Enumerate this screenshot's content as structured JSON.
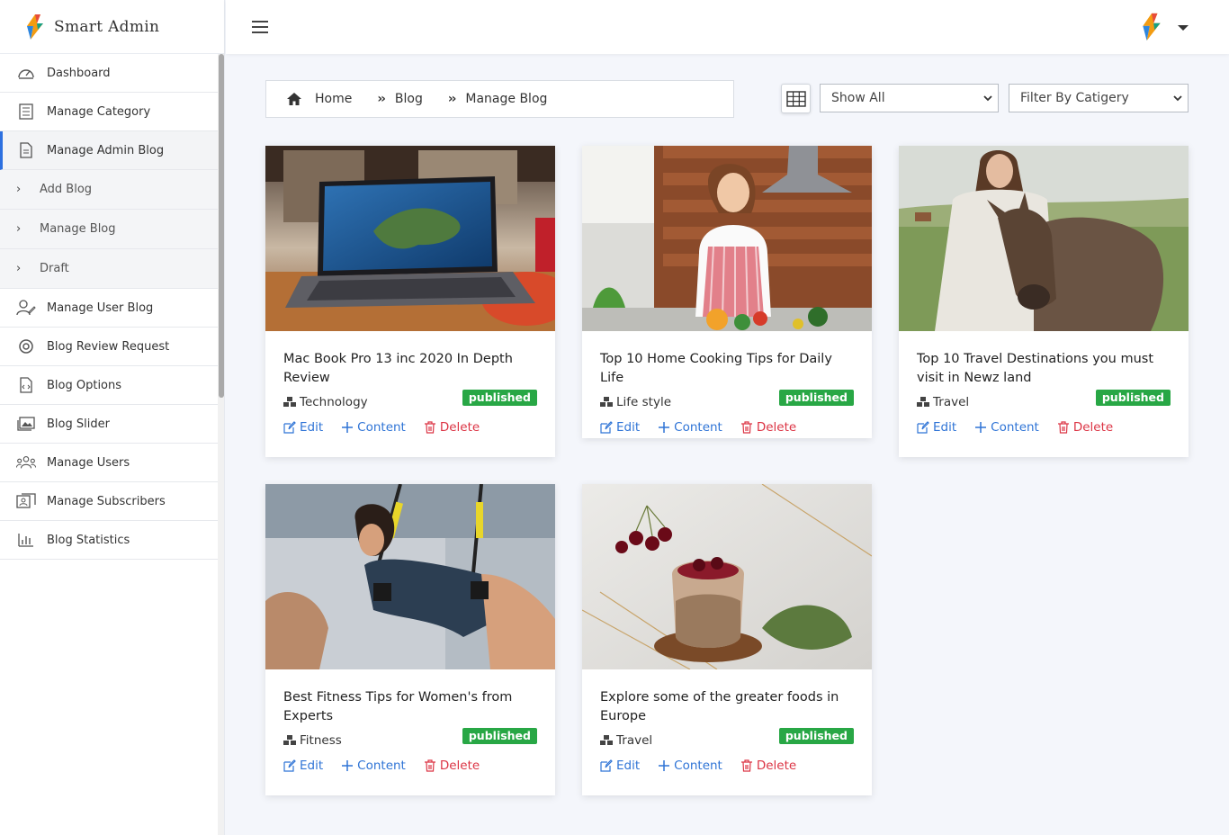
{
  "brand": {
    "name": "Smart Admin"
  },
  "sidebar": {
    "items": [
      {
        "label": "Dashboard",
        "icon": "dashboard-icon"
      },
      {
        "label": "Manage Category",
        "icon": "list-icon"
      },
      {
        "label": "Manage Admin Blog",
        "icon": "document-icon",
        "active": true
      },
      {
        "label": "Add Blog",
        "sub": true
      },
      {
        "label": "Manage Blog",
        "sub": true
      },
      {
        "label": "Draft",
        "sub": true
      },
      {
        "label": "Manage User Blog",
        "icon": "user-edit-icon"
      },
      {
        "label": "Blog Review Request",
        "icon": "review-icon"
      },
      {
        "label": "Blog Options",
        "icon": "file-code-icon"
      },
      {
        "label": "Blog Slider",
        "icon": "images-icon"
      },
      {
        "label": "Manage Users",
        "icon": "users-icon"
      },
      {
        "label": "Manage Subscribers",
        "icon": "subscribers-icon"
      },
      {
        "label": "Blog Statistics",
        "icon": "chart-icon"
      }
    ]
  },
  "breadcrumb": {
    "home": "Home",
    "blog": "Blog",
    "current": "Manage Blog"
  },
  "filters": {
    "show": "Show All",
    "category": "Filter By Catigery"
  },
  "actions": {
    "edit": "Edit",
    "content": "Content",
    "delete": "Delete"
  },
  "cards": [
    {
      "title": "Mac Book Pro 13 inc 2020 In Depth Review",
      "category": "Technology",
      "status": "published"
    },
    {
      "title": "Top 10 Home Cooking Tips for Daily Life",
      "category": "Life style",
      "status": "published"
    },
    {
      "title": "Top 10 Travel Destinations you must visit in Newz land",
      "category": "Travel",
      "status": "published"
    },
    {
      "title": "Best Fitness Tips for Women's from Experts",
      "category": "Fitness",
      "status": "published"
    },
    {
      "title": "Explore some of the greater foods in Europe",
      "category": "Travel",
      "status": "published"
    }
  ],
  "colors": {
    "accent": "#2d70e0",
    "published": "#28a745",
    "delete": "#dc3545",
    "link": "#2f74d6"
  }
}
